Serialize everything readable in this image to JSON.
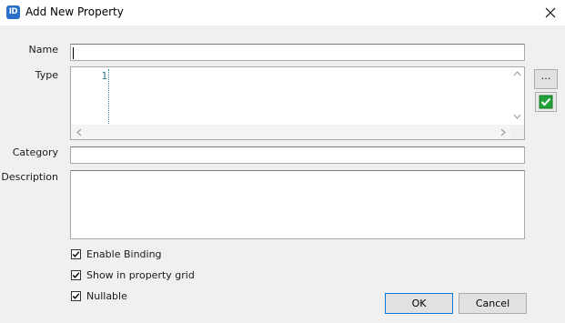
{
  "window": {
    "title": "Add New Property",
    "app_icon_text": "ID"
  },
  "form": {
    "name_label": "Name",
    "name_value": "",
    "type_label": "Type",
    "type_line_number": "1",
    "type_value": "",
    "category_label": "Category",
    "category_value": "",
    "description_label": "Description",
    "description_value": ""
  },
  "side_buttons": {
    "ellipsis_label": "...",
    "validate_icon": "green-check-icon"
  },
  "options": [
    {
      "label": "Enable Binding",
      "checked": true
    },
    {
      "label": "Show in property grid",
      "checked": true
    },
    {
      "label": "Nullable",
      "checked": true
    }
  ],
  "actions": {
    "ok_label": "OK",
    "cancel_label": "Cancel"
  },
  "colors": {
    "accent": "#0078d7",
    "dialog_bg": "#f0f0f0",
    "line_number": "#2b7a8a",
    "check_green": "#22a33a"
  }
}
